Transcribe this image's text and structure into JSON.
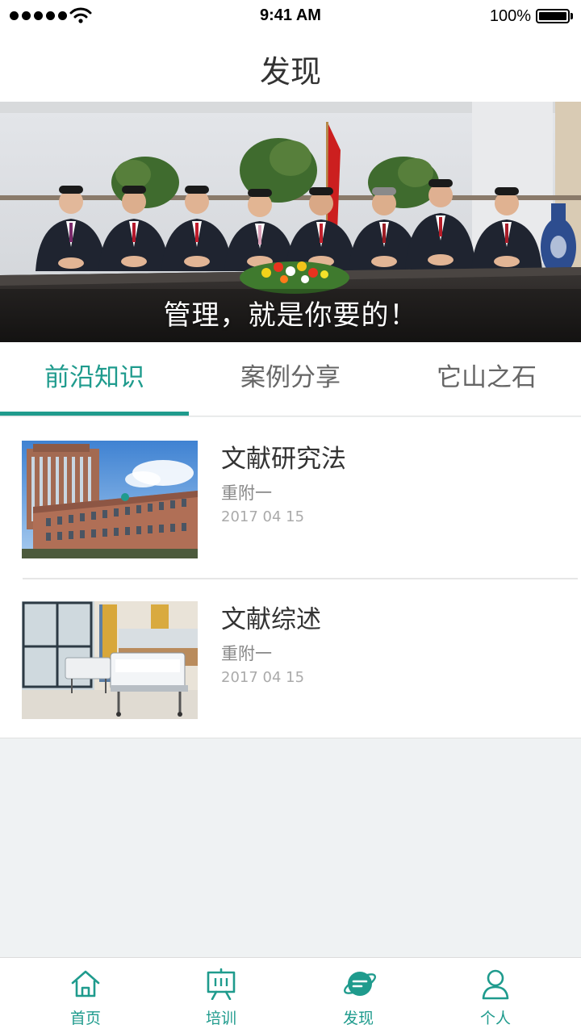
{
  "status_bar": {
    "time": "9:41 AM",
    "battery": "100%"
  },
  "header": {
    "title": "发现"
  },
  "banner": {
    "caption": "管理，就是你要的！"
  },
  "tabs": [
    {
      "label": "前沿知识",
      "active": true
    },
    {
      "label": "案例分享",
      "active": false
    },
    {
      "label": "它山之石",
      "active": false
    }
  ],
  "articles": [
    {
      "title": "文献研究法",
      "source": "重附一",
      "date": "2017 04 15",
      "thumbnail": "hospital-building"
    },
    {
      "title": "文献综述",
      "source": "重附一",
      "date": "2017 04 15",
      "thumbnail": "hospital-ward"
    }
  ],
  "tabbar": [
    {
      "label": "首页",
      "icon": "home-icon"
    },
    {
      "label": "培训",
      "icon": "training-board-icon"
    },
    {
      "label": "发现",
      "icon": "discover-planet-icon",
      "active": true
    },
    {
      "label": "个人",
      "icon": "person-icon"
    }
  ],
  "colors": {
    "accent": "#1f9b8d",
    "background": "#eff2f3"
  }
}
